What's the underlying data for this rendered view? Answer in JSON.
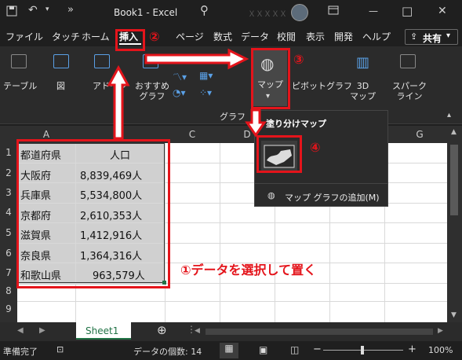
{
  "titlebar": {
    "title": "Book1 - Excel",
    "user_name": "ＸＸＸＸＸ",
    "controls": {
      "minimize": "—",
      "restore": "□",
      "close": "✕"
    }
  },
  "tabs": [
    {
      "label": "ファイル"
    },
    {
      "label": "タッチ"
    },
    {
      "label": "ホーム"
    },
    {
      "label": "挿入",
      "active": true
    },
    {
      "label": "ページ"
    },
    {
      "label": "数式"
    },
    {
      "label": "データ"
    },
    {
      "label": "校閲"
    },
    {
      "label": "表示"
    },
    {
      "label": "開発"
    },
    {
      "label": "ヘルプ"
    }
  ],
  "share_label": "共有",
  "ribbon": {
    "table": "テーブル",
    "illustrations": "図",
    "addins": "アドイン",
    "recommended_charts": "おすすめ\nグラフ",
    "maps": "マップ",
    "pivot_chart": "ピボットグラフ",
    "map3d": "3D\nマップ",
    "sparklines": "スパーク\nライン",
    "group_charts": "グラフ"
  },
  "dropdown": {
    "header": "塗り分けマップ",
    "add_map": "マップ グラフの追加(M)"
  },
  "columns": [
    "A",
    "B",
    "C",
    "D",
    "E",
    "F",
    "G"
  ],
  "rows": [
    "1",
    "2",
    "3",
    "4",
    "5",
    "6",
    "7",
    "8",
    "9"
  ],
  "table": {
    "header": [
      "都道府県",
      "人口"
    ],
    "rows": [
      [
        "大阪府",
        "8,839,469人"
      ],
      [
        "兵庫県",
        "5,534,800人"
      ],
      [
        "京都府",
        "2,610,353人"
      ],
      [
        "滋賀県",
        "1,412,916人"
      ],
      [
        "奈良県",
        "1,364,316人"
      ],
      [
        "和歌山県",
        "963,579人"
      ]
    ]
  },
  "sheet_tab": "Sheet1",
  "status": {
    "ready": "準備完了",
    "count": "データの個数: 14",
    "zoom": "100%"
  },
  "annotations": {
    "n1": "①データを選択して置く",
    "n2": "②",
    "n3": "③",
    "n4": "④"
  },
  "colors": {
    "accent": "#e4141b",
    "excel_green": "#217346"
  }
}
